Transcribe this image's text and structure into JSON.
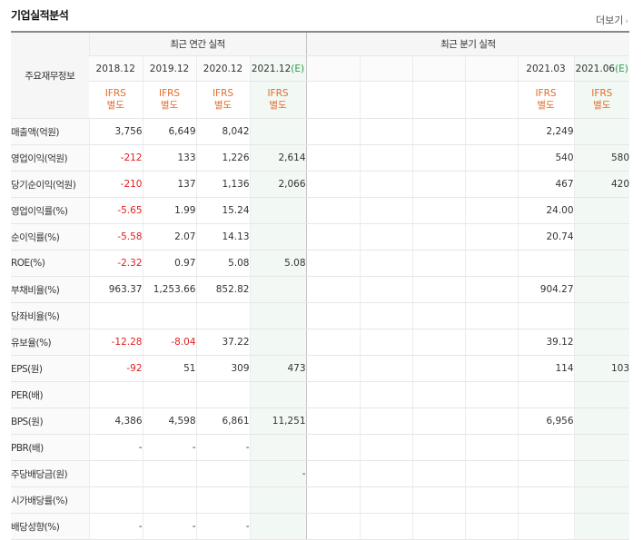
{
  "title": "기업실적분석",
  "more_label": "더보기",
  "headers": {
    "row_label": "주요재무정보",
    "annual_group": "최근 연간 실적",
    "quarter_group": "최근 분기 실적",
    "annual_dates": [
      "2018.12",
      "2019.12",
      "2020.12",
      "2021.12"
    ],
    "annual_est_suffix": "(E)",
    "quarter_dates": [
      "",
      "",
      "",
      "",
      "2021.03",
      "2021.06"
    ],
    "quarter_est_suffix": "(E)",
    "ifrs_line1": "IFRS",
    "ifrs_line2": "별도"
  },
  "rows": [
    {
      "label": "매출액(억원)",
      "annual": [
        "3,756",
        "6,649",
        "8,042",
        ""
      ],
      "quarter": [
        "",
        "",
        "",
        "",
        "2,249",
        ""
      ],
      "neg_annual": [
        false,
        false,
        false,
        false
      ],
      "neg_quarter": [
        false,
        false,
        false,
        false,
        false,
        false
      ],
      "sep": false
    },
    {
      "label": "영업이익(억원)",
      "annual": [
        "-212",
        "133",
        "1,226",
        "2,614"
      ],
      "quarter": [
        "",
        "",
        "",
        "",
        "540",
        "580"
      ],
      "neg_annual": [
        true,
        false,
        false,
        false
      ],
      "neg_quarter": [
        false,
        false,
        false,
        false,
        false,
        false
      ],
      "sep": false
    },
    {
      "label": "당기순이익(억원)",
      "annual": [
        "-210",
        "137",
        "1,136",
        "2,066"
      ],
      "quarter": [
        "",
        "",
        "",
        "",
        "467",
        "420"
      ],
      "neg_annual": [
        true,
        false,
        false,
        false
      ],
      "neg_quarter": [
        false,
        false,
        false,
        false,
        false,
        false
      ],
      "sep": false
    },
    {
      "label": "영업이익률(%)",
      "annual": [
        "-5.65",
        "1.99",
        "15.24",
        ""
      ],
      "quarter": [
        "",
        "",
        "",
        "",
        "24.00",
        ""
      ],
      "neg_annual": [
        true,
        false,
        false,
        false
      ],
      "neg_quarter": [
        false,
        false,
        false,
        false,
        false,
        false
      ],
      "sep": false
    },
    {
      "label": "순이익률(%)",
      "annual": [
        "-5.58",
        "2.07",
        "14.13",
        ""
      ],
      "quarter": [
        "",
        "",
        "",
        "",
        "20.74",
        ""
      ],
      "neg_annual": [
        true,
        false,
        false,
        false
      ],
      "neg_quarter": [
        false,
        false,
        false,
        false,
        false,
        false
      ],
      "sep": false
    },
    {
      "label": "ROE(%)",
      "annual": [
        "-2.32",
        "0.97",
        "5.08",
        "5.08"
      ],
      "quarter": [
        "",
        "",
        "",
        "",
        "",
        ""
      ],
      "neg_annual": [
        true,
        false,
        false,
        false
      ],
      "neg_quarter": [
        false,
        false,
        false,
        false,
        false,
        false
      ],
      "sep": false
    },
    {
      "label": "부채비율(%)",
      "annual": [
        "963.37",
        "1,253.66",
        "852.82",
        ""
      ],
      "quarter": [
        "",
        "",
        "",
        "",
        "904.27",
        ""
      ],
      "neg_annual": [
        false,
        false,
        false,
        false
      ],
      "neg_quarter": [
        false,
        false,
        false,
        false,
        false,
        false
      ],
      "sep": true
    },
    {
      "label": "당좌비율(%)",
      "annual": [
        "",
        "",
        "",
        ""
      ],
      "quarter": [
        "",
        "",
        "",
        "",
        "",
        ""
      ],
      "neg_annual": [
        false,
        false,
        false,
        false
      ],
      "neg_quarter": [
        false,
        false,
        false,
        false,
        false,
        false
      ],
      "sep": false
    },
    {
      "label": "유보율(%)",
      "annual": [
        "-12.28",
        "-8.04",
        "37.22",
        ""
      ],
      "quarter": [
        "",
        "",
        "",
        "",
        "39.12",
        ""
      ],
      "neg_annual": [
        true,
        true,
        false,
        false
      ],
      "neg_quarter": [
        false,
        false,
        false,
        false,
        false,
        false
      ],
      "sep": false
    },
    {
      "label": "EPS(원)",
      "annual": [
        "-92",
        "51",
        "309",
        "473"
      ],
      "quarter": [
        "",
        "",
        "",
        "",
        "114",
        "103"
      ],
      "neg_annual": [
        true,
        false,
        false,
        false
      ],
      "neg_quarter": [
        false,
        false,
        false,
        false,
        false,
        false
      ],
      "sep": true
    },
    {
      "label": "PER(배)",
      "annual": [
        "",
        "",
        "",
        ""
      ],
      "quarter": [
        "",
        "",
        "",
        "",
        "",
        ""
      ],
      "neg_annual": [
        false,
        false,
        false,
        false
      ],
      "neg_quarter": [
        false,
        false,
        false,
        false,
        false,
        false
      ],
      "sep": false
    },
    {
      "label": "BPS(원)",
      "annual": [
        "4,386",
        "4,598",
        "6,861",
        "11,251"
      ],
      "quarter": [
        "",
        "",
        "",
        "",
        "6,956",
        ""
      ],
      "neg_annual": [
        false,
        false,
        false,
        false
      ],
      "neg_quarter": [
        false,
        false,
        false,
        false,
        false,
        false
      ],
      "sep": false
    },
    {
      "label": "PBR(배)",
      "annual": [
        "-",
        "-",
        "-",
        ""
      ],
      "quarter": [
        "",
        "",
        "",
        "",
        "",
        ""
      ],
      "neg_annual": [
        false,
        false,
        false,
        false
      ],
      "neg_quarter": [
        false,
        false,
        false,
        false,
        false,
        false
      ],
      "sep": false
    },
    {
      "label": "주당배당금(원)",
      "annual": [
        "",
        "",
        "",
        "-"
      ],
      "quarter": [
        "",
        "",
        "",
        "",
        "",
        ""
      ],
      "neg_annual": [
        false,
        false,
        false,
        false
      ],
      "neg_quarter": [
        false,
        false,
        false,
        false,
        false,
        false
      ],
      "sep": true
    },
    {
      "label": "시가배당률(%)",
      "annual": [
        "",
        "",
        "",
        ""
      ],
      "quarter": [
        "",
        "",
        "",
        "",
        "",
        ""
      ],
      "neg_annual": [
        false,
        false,
        false,
        false
      ],
      "neg_quarter": [
        false,
        false,
        false,
        false,
        false,
        false
      ],
      "sep": false
    },
    {
      "label": "배당성향(%)",
      "annual": [
        "-",
        "-",
        "-",
        ""
      ],
      "quarter": [
        "",
        "",
        "",
        "",
        "",
        ""
      ],
      "neg_annual": [
        false,
        false,
        false,
        false
      ],
      "neg_quarter": [
        false,
        false,
        false,
        false,
        false,
        false
      ],
      "sep": false
    }
  ],
  "colors": {
    "negative": "#e02020",
    "ifrs": "#e46c2b",
    "estimate": "#2a9d4a"
  }
}
